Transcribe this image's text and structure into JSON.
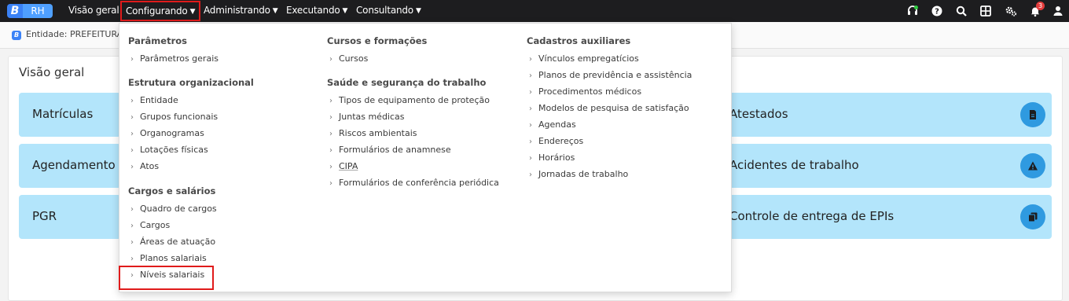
{
  "brand": {
    "b": "B",
    "rh": "RH"
  },
  "nav": [
    {
      "label": "Visão geral",
      "has_menu": false
    },
    {
      "label": "Configurando",
      "has_menu": true,
      "active": true
    },
    {
      "label": "Administrando",
      "has_menu": true
    },
    {
      "label": "Executando",
      "has_menu": true
    },
    {
      "label": "Consultando",
      "has_menu": true
    }
  ],
  "top_icons": [
    "headset-icon",
    "help-icon",
    "search-icon",
    "apps-grid-icon",
    "settings-gears-icon",
    "bell-icon",
    "user-icon"
  ],
  "notifications_count": "3",
  "entity": {
    "icon": "B",
    "text": "Entidade: PREFEITURA D"
  },
  "main": {
    "title": "Visão geral",
    "cards_left": [
      "Matrículas",
      "Agendamento",
      "PGR"
    ],
    "cards_right": [
      {
        "label": "Atestados",
        "icon": "document-icon"
      },
      {
        "label": "Acidentes de trabalho",
        "icon": "warning-icon"
      },
      {
        "label": "Controle de entrega de EPIs",
        "icon": "copy-icon"
      }
    ]
  },
  "menu": {
    "col1": [
      {
        "title": "Parâmetros",
        "items": [
          "Parâmetros gerais"
        ]
      },
      {
        "title": "Estrutura organizacional",
        "items": [
          "Entidade",
          "Grupos funcionais",
          "Organogramas",
          "Lotações físicas",
          "Atos"
        ]
      },
      {
        "title": "Cargos e salários",
        "items": [
          "Quadro de cargos",
          "Cargos",
          "Áreas de atuação",
          "Planos salariais",
          "Níveis salariais"
        ]
      }
    ],
    "col2": [
      {
        "title": "Cursos e formações",
        "items": [
          "Cursos"
        ]
      },
      {
        "title": "Saúde e segurança do trabalho",
        "items": [
          "Tipos de equipamento de proteção",
          "Juntas médicas",
          "Riscos ambientais",
          "Formulários de anamnese",
          "CIPA",
          "Formulários de conferência periódica"
        ]
      }
    ],
    "col3": [
      {
        "title": "Cadastros auxiliares",
        "items": [
          "Vínculos empregatícios",
          "Planos de previdência e assistência",
          "Procedimentos médicos",
          "Modelos de pesquisa de satisfação",
          "Agendas",
          "Endereços",
          "Horários",
          "Jornadas de trabalho"
        ]
      }
    ],
    "highlighted_item": "Níveis salariais"
  },
  "colors": {
    "topbar": "#1d1d1f",
    "card": "#b3e5fb",
    "card_button": "#2f9ae0",
    "highlight": "#e01b1b"
  }
}
